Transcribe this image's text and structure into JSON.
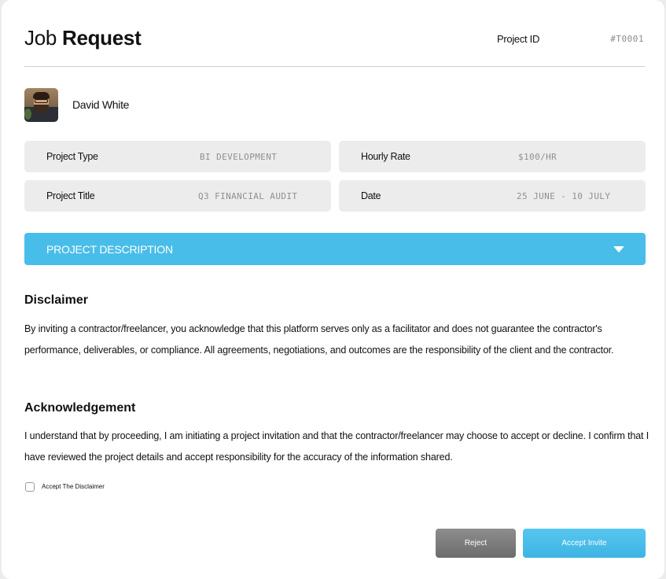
{
  "header": {
    "title_light": "Job",
    "title_bold": "Request",
    "project_id_label": "Project ID",
    "project_id_value": "#T0001"
  },
  "user": {
    "name": "David White"
  },
  "details": {
    "project_type": {
      "label": "Project Type",
      "value": "BI DEVELOPMENT"
    },
    "hourly_rate": {
      "label": "Hourly Rate",
      "value": "$100/HR"
    },
    "project_title": {
      "label": "Project Title",
      "value": "Q3 FINANCIAL AUDIT"
    },
    "date": {
      "label": "Date",
      "value": "25 JUNE - 10 JULY"
    }
  },
  "accordion": {
    "label": "PROJECT DESCRIPTION",
    "icon": "chevron-down-icon",
    "expanded": false
  },
  "disclaimer": {
    "heading": "Disclaimer",
    "text": "By inviting a contractor/freelancer, you acknowledge that this platform serves only as a facilitator and does not guarantee the contractor's performance, deliverables, or compliance. All agreements, negotiations, and outcomes are the responsibility of the client and the contractor."
  },
  "acknowledgement": {
    "heading": "Acknowledgement",
    "text": "I understand that by proceeding, I am initiating a project invitation and that the contractor/freelancer may choose to accept or  decline. I confirm that I have reviewed the project details and accept responsibility for the accuracy of the information shared."
  },
  "checkbox": {
    "label": "Accept The Disclaimer",
    "checked": false
  },
  "actions": {
    "reject_label": "Reject",
    "accept_label": "Accept Invite"
  },
  "colors": {
    "accent": "#49bde9",
    "reject": "#747474",
    "info_box": "#ececec"
  }
}
